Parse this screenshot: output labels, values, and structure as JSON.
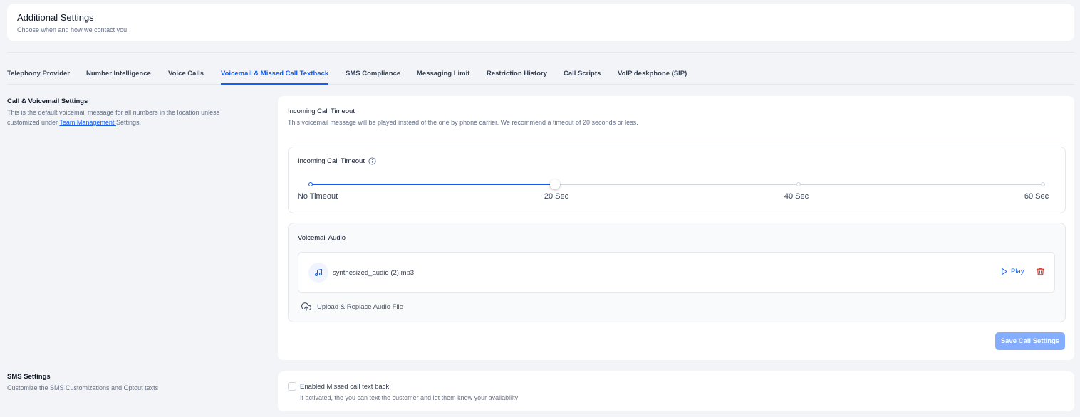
{
  "header": {
    "title": "Additional Settings",
    "subtitle": "Choose when and how we contact you."
  },
  "tabs": [
    {
      "label": "Telephony Provider",
      "active": false
    },
    {
      "label": "Number Intelligence",
      "active": false
    },
    {
      "label": "Voice Calls",
      "active": false
    },
    {
      "label": "Voicemail & Missed Call Textback",
      "active": true
    },
    {
      "label": "SMS Compliance",
      "active": false
    },
    {
      "label": "Messaging Limit",
      "active": false
    },
    {
      "label": "Restriction History",
      "active": false
    },
    {
      "label": "Call Scripts",
      "active": false
    },
    {
      "label": "VoIP deskphone (SIP)",
      "active": false
    }
  ],
  "call_section": {
    "title": "Call & Voicemail Settings",
    "desc_line1": "This is the default voicemail message for all numbers in the location unless",
    "desc_prefix": "customized under ",
    "desc_link": "Team Management ",
    "desc_suffix": "Settings."
  },
  "incoming_call_timeout": {
    "title": "Incoming Call Timeout",
    "description": "This voicemail message will be played instead of the one by phone carrier. We recommend a timeout of 20 seconds or less.",
    "slider_label": "Incoming Call Timeout",
    "marks": [
      "No Timeout",
      "20 Sec",
      "40 Sec",
      "60 Sec"
    ],
    "selected": "20 Sec",
    "selected_fraction": 0.3333
  },
  "voicemail_audio": {
    "title": "Voicemail Audio",
    "file_name": "synthesized_audio (2).mp3",
    "play_label": "Play",
    "upload_label": "Upload & Replace Audio File"
  },
  "save_button": "Save Call Settings",
  "sms_section": {
    "title": "SMS Settings",
    "desc": "Customize the SMS Customizations and Optout texts",
    "checkbox_label": "Enabled Missed call text back",
    "checkbox_checked": false,
    "checkbox_desc": "If activated, the you can text the customer and let them know your availability"
  },
  "colors": {
    "accent": "#155eef",
    "button_disabled": "#84adff",
    "danger": "#d92d20"
  }
}
